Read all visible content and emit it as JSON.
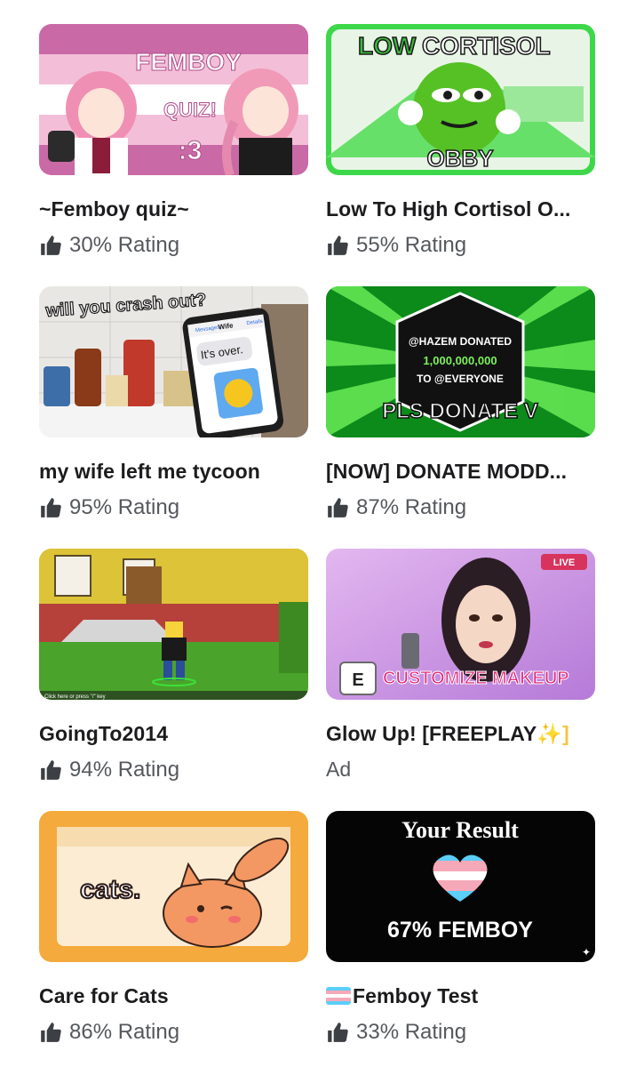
{
  "games": [
    {
      "title": "~Femboy quiz~",
      "rating": "30% Rating",
      "thumb_text": [
        "FEMBOY",
        "QUIZ!",
        ":3"
      ]
    },
    {
      "title": "Low To High Cortisol O...",
      "rating": "55% Rating",
      "thumb_text": [
        "LOW",
        "CORTISOL",
        "OBBY"
      ]
    },
    {
      "title": "my wife left me tycoon",
      "rating": "95% Rating",
      "thumb_text": [
        "will you crash out?",
        "It's over.",
        "Wife",
        "Messages",
        "Details"
      ]
    },
    {
      "title": "[NOW] DONATE MODD...",
      "rating": "87% Rating",
      "thumb_text": [
        "@HAZEM DONATED",
        "1,000,000,000",
        "TO @EVERYONE",
        "PLS DONATE V"
      ]
    },
    {
      "title": "GoingTo2014",
      "rating": "94% Rating",
      "thumb_text": [
        "Click here or press \"/\" key"
      ]
    },
    {
      "title": "Glow Up! [FREEPLAY",
      "title_suffix": "✨]",
      "ad_label": "Ad",
      "thumb_text": [
        "LIVE",
        "E",
        "CUSTOMIZE MAKEUP"
      ]
    },
    {
      "title": "Care for Cats",
      "rating": "86% Rating",
      "thumb_text": [
        "cats."
      ]
    },
    {
      "title": "Femboy Test",
      "rating": "33% Rating",
      "thumb_text": [
        "Your Result",
        "67% FEMBOY"
      ]
    }
  ],
  "icons": {
    "rating": "thumbs-up-icon",
    "flag": "transgender-flag-icon",
    "live": "broadcast-icon"
  },
  "colors": {
    "text": "#1c1c1e",
    "muted": "#55585c",
    "trans_blue": "#5bcefa",
    "trans_pink": "#f5a9b8"
  }
}
